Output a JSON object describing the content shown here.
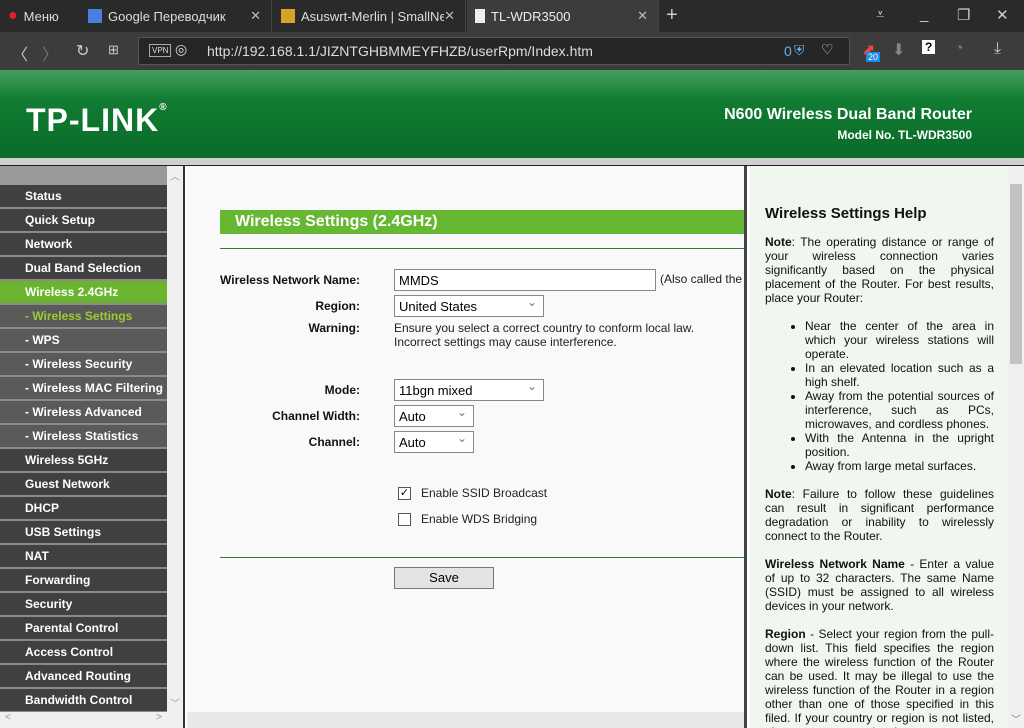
{
  "browser": {
    "menu_label": "Меню",
    "tabs": [
      {
        "title": "Google Переводчик"
      },
      {
        "title": "Asuswrt-Merlin | SmallNet"
      },
      {
        "title": "TL-WDR3500"
      }
    ],
    "url": "http://192.168.1.1/JIZNTGHBMMEYFHZB/userRpm/Index.htm",
    "vpn_label": "VPN",
    "adblock_count": "0",
    "ext_badge": "20"
  },
  "banner": {
    "logo": "TP-LINK",
    "product": "N600 Wireless Dual Band Router",
    "model": "Model No. TL-WDR3500"
  },
  "sidebar": {
    "items": [
      {
        "label": "Status",
        "type": "main"
      },
      {
        "label": "Quick Setup",
        "type": "main"
      },
      {
        "label": "Network",
        "type": "main"
      },
      {
        "label": "Dual Band Selection",
        "type": "main"
      },
      {
        "label": "Wireless 2.4GHz",
        "type": "active"
      },
      {
        "label": "- Wireless Settings",
        "type": "cur"
      },
      {
        "label": "- WPS",
        "type": "sub"
      },
      {
        "label": "- Wireless Security",
        "type": "sub"
      },
      {
        "label": "- Wireless MAC Filtering",
        "type": "sub"
      },
      {
        "label": "- Wireless Advanced",
        "type": "sub"
      },
      {
        "label": "- Wireless Statistics",
        "type": "sub"
      },
      {
        "label": "Wireless 5GHz",
        "type": "main"
      },
      {
        "label": "Guest Network",
        "type": "main"
      },
      {
        "label": "DHCP",
        "type": "main"
      },
      {
        "label": "USB Settings",
        "type": "main"
      },
      {
        "label": "NAT",
        "type": "main"
      },
      {
        "label": "Forwarding",
        "type": "main"
      },
      {
        "label": "Security",
        "type": "main"
      },
      {
        "label": "Parental Control",
        "type": "main"
      },
      {
        "label": "Access Control",
        "type": "main"
      },
      {
        "label": "Advanced Routing",
        "type": "main"
      },
      {
        "label": "Bandwidth Control",
        "type": "main"
      }
    ]
  },
  "form": {
    "title": "Wireless Settings (2.4GHz)",
    "ssid_label": "Wireless Network Name:",
    "ssid_value": "MMDS",
    "ssid_note": "(Also called the",
    "region_label": "Region:",
    "region_value": "United States",
    "warning_label": "Warning:",
    "warning_1": "Ensure you select a correct country to conform local law.",
    "warning_2": "Incorrect settings may cause interference.",
    "mode_label": "Mode:",
    "mode_value": "11bgn mixed",
    "width_label": "Channel Width:",
    "width_value": "Auto",
    "channel_label": "Channel:",
    "channel_value": "Auto",
    "ssid_broadcast_label": "Enable SSID Broadcast",
    "ssid_broadcast_checked": true,
    "wds_label": "Enable WDS Bridging",
    "wds_checked": false,
    "save_label": "Save"
  },
  "help": {
    "title": "Wireless Settings Help",
    "note1_b": "Note",
    "note1": ": The operating distance or range of your wireless connection varies significantly based on the physical placement of the Router. For best results, place your Router:",
    "bullets": [
      "Near the center of the area in which your wireless stations will operate.",
      "In an elevated location such as a high shelf.",
      "Away from the potential sources of interference, such as PCs, microwaves, and cordless phones.",
      "With the Antenna in the upright position.",
      "Away from large metal surfaces."
    ],
    "note2_b": "Note",
    "note2": ": Failure to follow these guidelines can result in significant performance degradation or inability to wirelessly connect to the Router.",
    "ssid_b": "Wireless Network Name",
    "ssid": " - Enter a value of up to 32 characters. The same Name (SSID) must be assigned to all wireless devices in your network.",
    "region_b": "Region",
    "region": " - Select your region from the pull-down list. This field specifies the region where the wireless function of the Router can be used. It may be illegal to use the wireless function of the Router in a region other than one of those specified in this filed. If your country or region is not listed, please contact your local government"
  }
}
